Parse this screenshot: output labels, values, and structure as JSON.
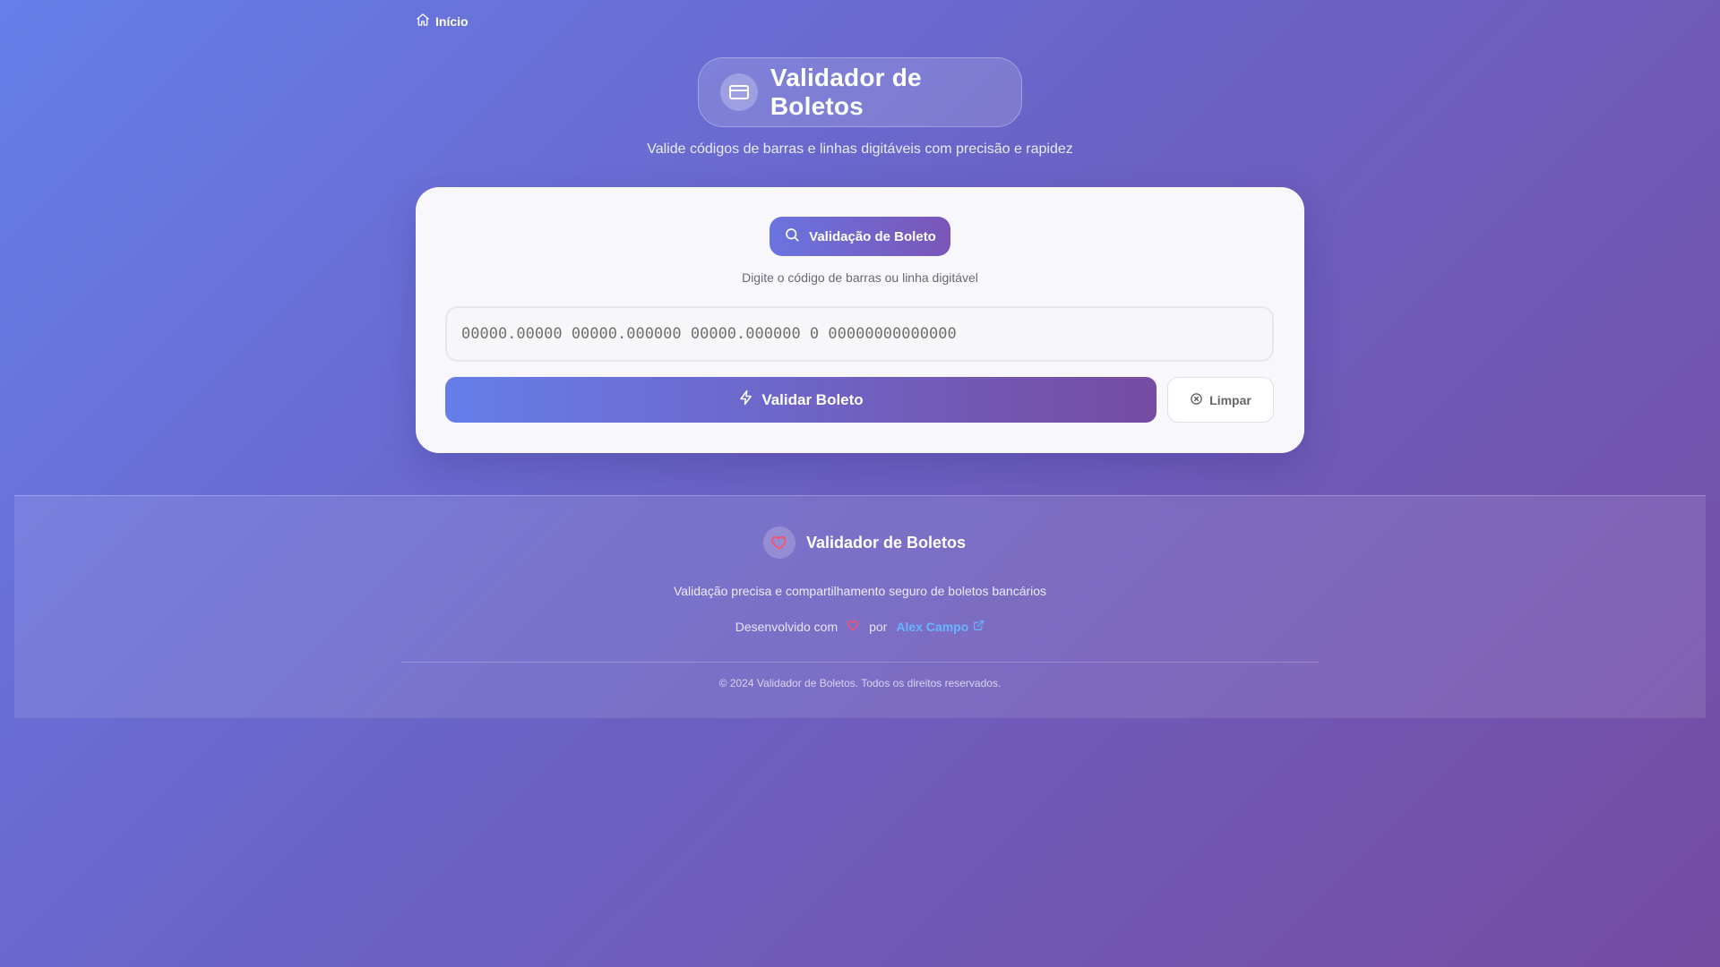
{
  "nav": {
    "home_label": "Início",
    "home_icon": "home-icon"
  },
  "hero": {
    "title": "Validador de Boletos",
    "icon": "credit-card-icon",
    "subtitle": "Valide códigos de barras e linhas digitáveis com precisão e rapidez"
  },
  "validator": {
    "badge_label": "Validação de Boleto",
    "badge_icon": "search-icon",
    "instruction": "Digite o código de barras ou linha digitável",
    "input_value": "",
    "input_placeholder": "00000.00000 00000.000000 00000.000000 0 00000000000000",
    "validate_label": "Validar Boleto",
    "validate_icon": "lightning-icon",
    "clear_label": "Limpar",
    "clear_icon": "x-circle-icon"
  },
  "footer": {
    "brand": "Validador de Boletos",
    "brand_icon": "heart-icon",
    "tagline": "Validação precisa e compartilhamento seguro de boletos bancários",
    "credit_prefix": "Desenvolvido com",
    "credit_by": "por",
    "author": "Alex Campo",
    "copyright": "© 2024 Validador de Boletos. Todos os direitos reservados."
  },
  "colors": {
    "gradient_start": "#667eea",
    "gradient_end": "#764ba2",
    "heart": "#ff4d6d",
    "link": "#66b5ff"
  }
}
